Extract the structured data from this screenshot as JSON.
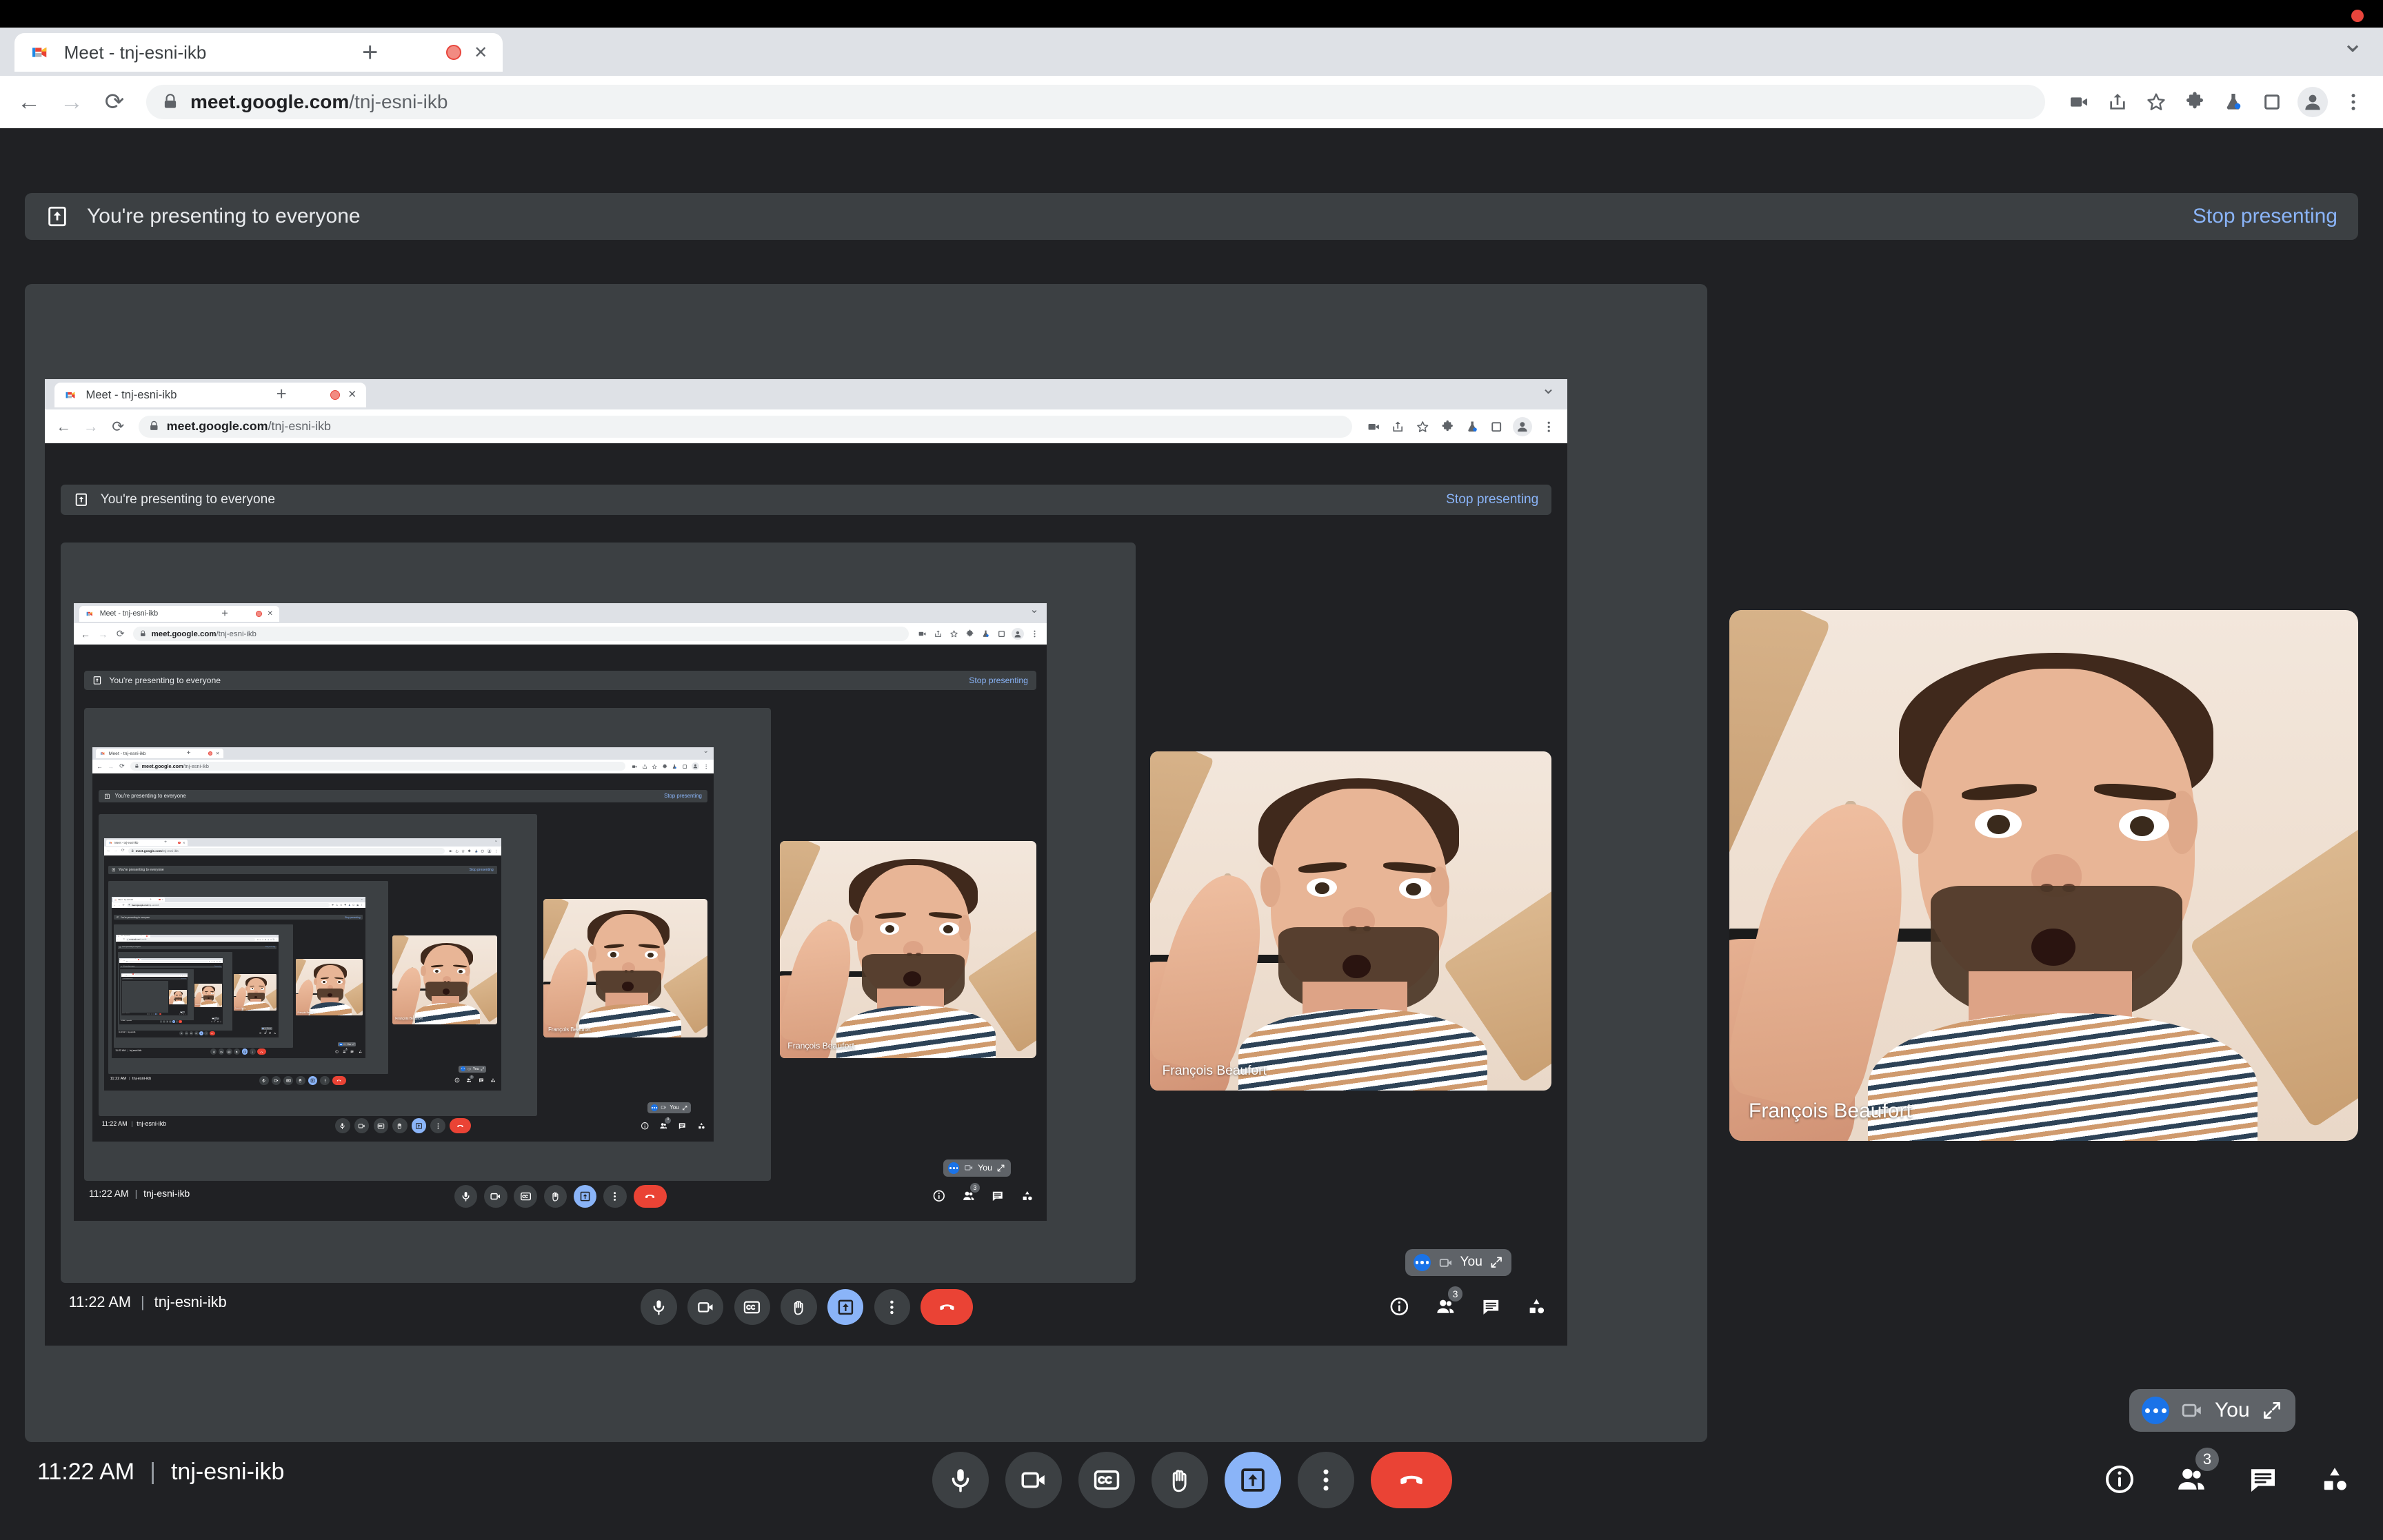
{
  "window": {
    "background": "#000000",
    "recording_indicator": "rec-dot"
  },
  "browser": {
    "tab": {
      "favicon": "google-meet-favicon",
      "title": "Meet - tnj-esni-ikb",
      "recording_badge": "tab-recording-icon",
      "close_label": "✕"
    },
    "new_tab_label": "+",
    "tabstrip_chevron": "⌄",
    "nav": {
      "back": "←",
      "forward": "→",
      "reload": "⟳"
    },
    "omnibox": {
      "lock_icon": "lock-icon",
      "url_domain": "meet.google.com",
      "url_path": "/tnj-esni-ikb",
      "full_url": "meet.google.com/tnj-esni-ikb"
    },
    "toolbar_icons": [
      "video-camera-icon",
      "share-icon",
      "star-bookmark-icon",
      "extensions-puzzle-icon",
      "labs-flask-icon",
      "side-panel-icon",
      "profile-avatar-icon",
      "three-dot-menu-icon"
    ]
  },
  "meet": {
    "present_banner": {
      "icon": "present-to-screen-icon",
      "text": "You're presenting to everyone",
      "stop_label": "Stop presenting",
      "stop_color": "#8ab4f8",
      "background": "#3c4043"
    },
    "participant": {
      "name": "François Beaufort"
    },
    "self_pill": {
      "more_icon": "three-dots-blue-icon",
      "camera_icon": "camera-outline-icon",
      "label": "You",
      "expand_icon": "expand-diagonal-icon"
    },
    "bottom_bar": {
      "time": "11:22 AM",
      "separator": "|",
      "meeting_code": "tnj-esni-ikb",
      "controls": [
        {
          "name": "microphone-button",
          "icon": "mic-icon",
          "state": "off",
          "label": "Mute"
        },
        {
          "name": "camera-button",
          "icon": "camera-icon",
          "state": "off",
          "label": "Turn off camera"
        },
        {
          "name": "captions-button",
          "icon": "cc-icon",
          "state": "off",
          "label": "Turn on captions"
        },
        {
          "name": "raise-hand-button",
          "icon": "hand-icon",
          "state": "off",
          "label": "Raise hand"
        },
        {
          "name": "present-now-button",
          "icon": "present-icon",
          "state": "active",
          "label": "Present now"
        },
        {
          "name": "more-options-button",
          "icon": "more-icon",
          "state": "off",
          "label": "More options"
        },
        {
          "name": "leave-call-button",
          "icon": "hangup-icon",
          "state": "end",
          "label": "Leave call"
        }
      ],
      "right_icons": [
        {
          "name": "meeting-details-button",
          "icon": "info-icon",
          "badge": ""
        },
        {
          "name": "people-button",
          "icon": "people-icon",
          "badge": "3"
        },
        {
          "name": "chat-button",
          "icon": "chat-icon",
          "badge": ""
        },
        {
          "name": "activities-button",
          "icon": "activities-icon",
          "badge": ""
        }
      ]
    }
  },
  "recursion": {
    "levels": 9,
    "description": "Droste effect: the shared screen shows the same Meet window recursively"
  },
  "colors": {
    "page_bg": "#202124",
    "banner_bg": "#3c4043",
    "accent_blue": "#8ab4f8",
    "end_red": "#ea4335",
    "chrome_tabstrip": "#dee1e6",
    "chrome_toolbar": "#ffffff",
    "omnibox_bg": "#f1f3f4"
  }
}
